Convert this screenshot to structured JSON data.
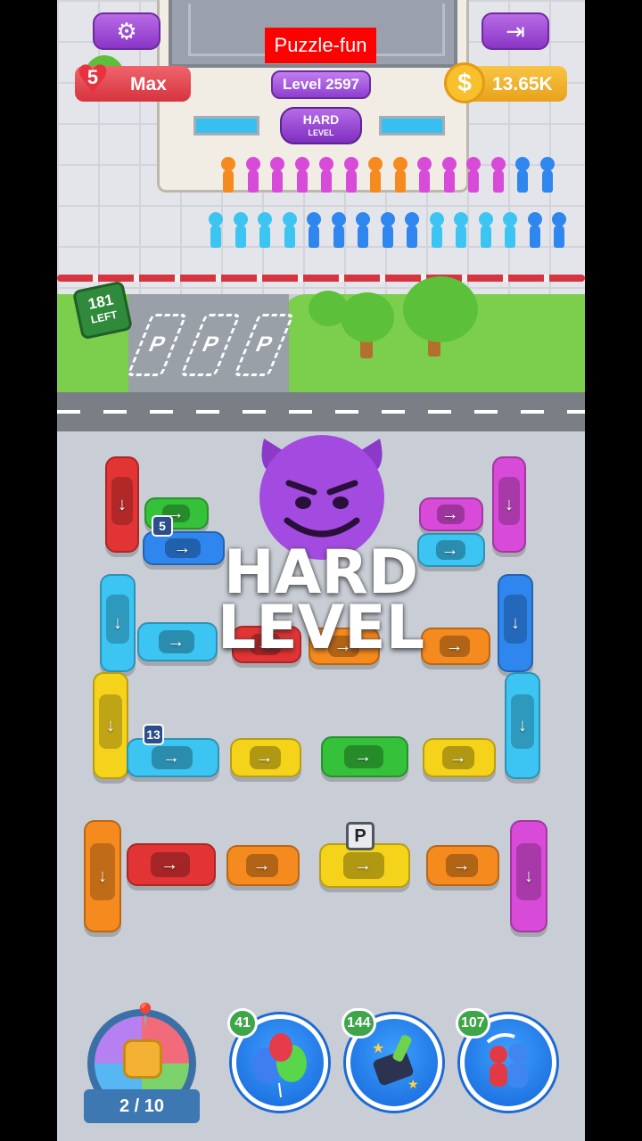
{
  "hud": {
    "watermark": "Puzzle-fun",
    "lives": "5",
    "lives_label": "Max",
    "level": "Level 2597",
    "difficulty_top": "HARD",
    "difficulty_bottom": "LEVEL",
    "coin_symbol": "$",
    "coins": "13.65K",
    "settings_icon": "gear-icon",
    "exit_icon": "exit-door-icon"
  },
  "parking_board": {
    "count": "181",
    "label": "LEFT"
  },
  "parking_spot_label": "P",
  "overlay": {
    "line1": "HARD",
    "line2": "LEVEL"
  },
  "cars": {
    "badge_a": "5",
    "badge_b": "13",
    "parking_sign": "P",
    "arrow_right": "→",
    "arrow_down": "↓"
  },
  "bottom": {
    "progress": "2 / 10",
    "boosters": [
      {
        "name": "balloons",
        "count": "41"
      },
      {
        "name": "brush",
        "count": "144"
      },
      {
        "name": "shuffle-people",
        "count": "107"
      }
    ]
  },
  "colors": {
    "red": "#e23434",
    "green": "#35c23a",
    "blue": "#2f86ee",
    "cyan": "#3cc4f2",
    "yellow": "#f5d31b",
    "orange": "#f58a1f",
    "magenta": "#d84ad8",
    "purple": "#8a36c6"
  }
}
